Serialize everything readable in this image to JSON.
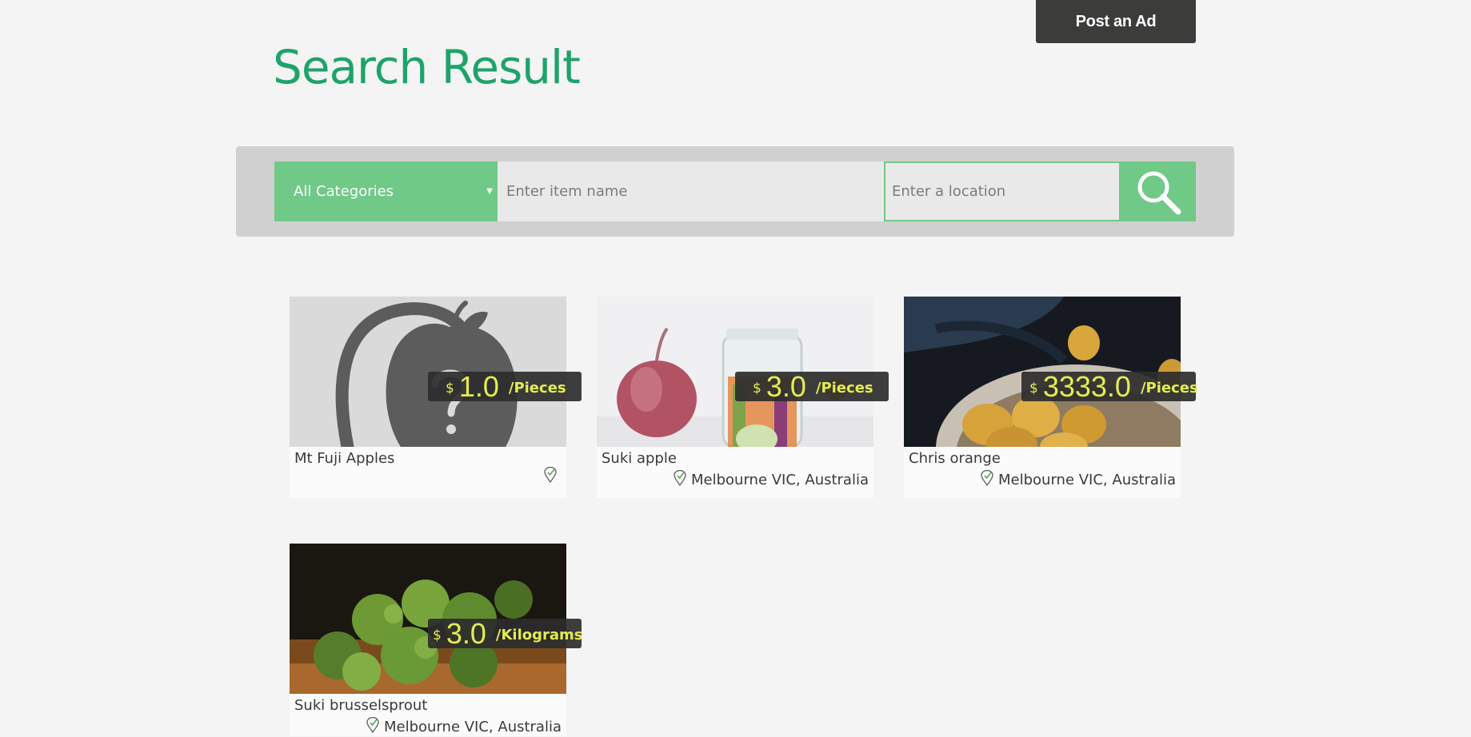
{
  "header": {
    "post_ad_label": "Post an Ad",
    "title": "Search Result"
  },
  "search": {
    "category": "All Categories",
    "item_placeholder": "Enter item name",
    "location_placeholder": "Enter a location",
    "button_icon": "search-icon"
  },
  "results": [
    {
      "name": "Mt Fuji Apples",
      "currency": "$",
      "price": "1.0",
      "unit": "/Pieces",
      "location": "",
      "image": "placeholder-apple-icon"
    },
    {
      "name": "Suki apple",
      "currency": "$",
      "price": "3.0",
      "unit": "/Pieces",
      "location": "Melbourne VIC, Australia",
      "image": "onion-and-jar-photo"
    },
    {
      "name": "Chris orange",
      "currency": "$",
      "price": "3333.0",
      "unit": "/Pieces",
      "location": "Melbourne VIC, Australia",
      "image": "potatoes-in-bowl-photo"
    },
    {
      "name": "Suki brusselsprout",
      "currency": "$",
      "price": "3.0",
      "unit": "/Kilograms",
      "location": "Melbourne VIC, Australia",
      "image": "brussels-sprouts-photo"
    }
  ],
  "colors": {
    "accent_green": "#1ea36a",
    "button_green": "#70c987",
    "price_text": "#e4ec52",
    "dark": "#3c3d3b"
  }
}
